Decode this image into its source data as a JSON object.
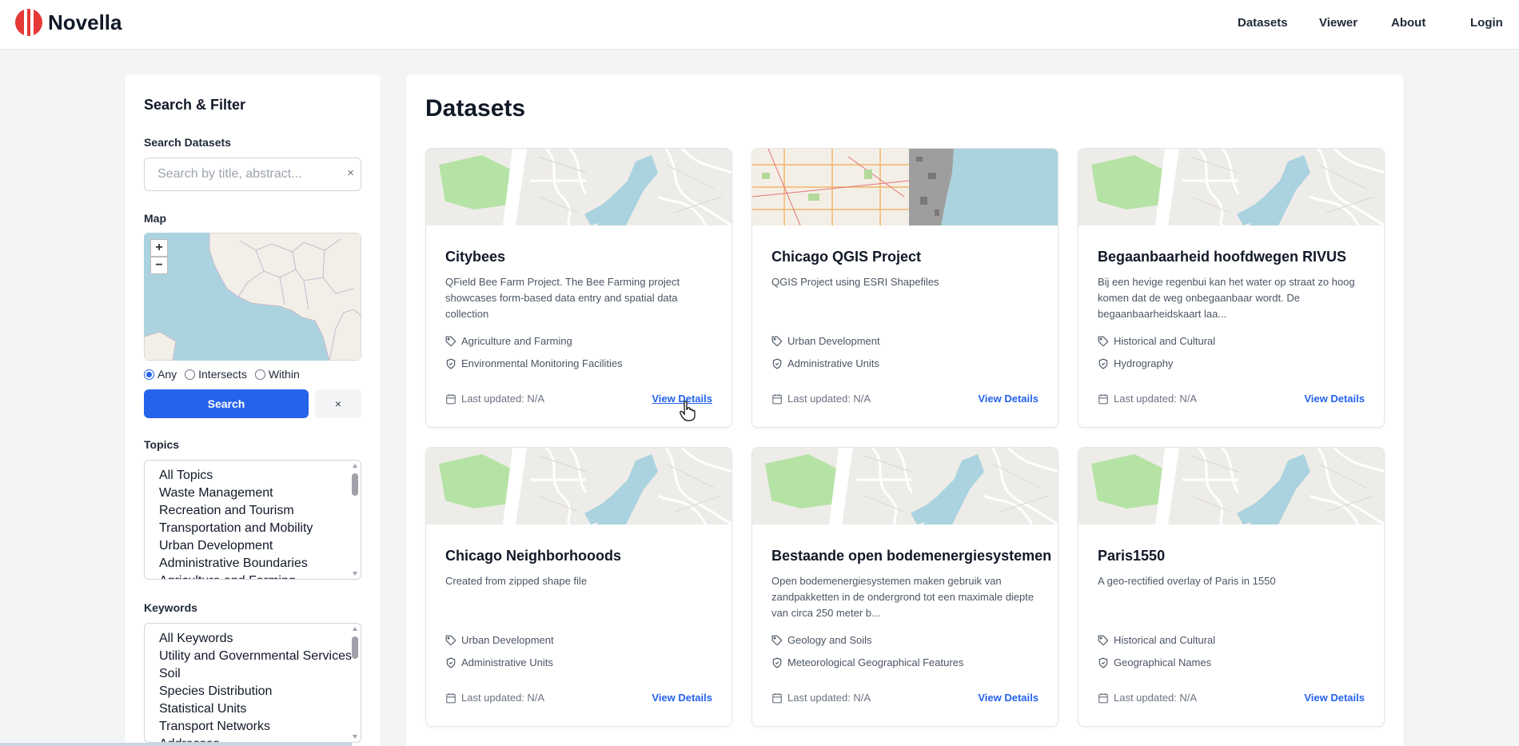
{
  "header": {
    "brand": "Novella",
    "nav": [
      "Datasets",
      "Viewer",
      "About",
      "Login"
    ]
  },
  "sidebar": {
    "title": "Search & Filter",
    "search_label": "Search Datasets",
    "search_placeholder": "Search by title, abstract...",
    "search_clear": "×",
    "map_label": "Map",
    "zoom_in": "+",
    "zoom_out": "−",
    "spatial_options": [
      "Any",
      "Intersects",
      "Within"
    ],
    "spatial_selected": "Any",
    "search_button": "Search",
    "clear_button": "×",
    "topics_label": "Topics",
    "topics": [
      "All Topics",
      "Waste Management",
      "Recreation and Tourism",
      "Transportation and Mobility",
      "Urban Development",
      "Administrative Boundaries",
      "Agriculture and Farming"
    ],
    "keywords_label": "Keywords",
    "keywords": [
      "All Keywords",
      "Utility and Governmental Services",
      "Soil",
      "Species Distribution",
      "Statistical Units",
      "Transport Networks",
      "Addresses"
    ]
  },
  "main": {
    "title": "Datasets",
    "updated_label": "Last updated: N/A",
    "details_label": "View Details",
    "cards": [
      {
        "title": "Citybees",
        "desc": "QField Bee Farm Project. The Bee Farming project showcases form-based data entry and spatial data collection",
        "topic": "Agriculture and Farming",
        "keyword": "Environmental Monitoring Facilities",
        "map": "generic"
      },
      {
        "title": "Chicago QGIS Project",
        "desc": "QGIS Project using ESRI Shapefiles",
        "topic": "Urban Development",
        "keyword": "Administrative Units",
        "map": "chicago"
      },
      {
        "title": "Begaanbaarheid hoofdwegen RIVUS",
        "desc": "Bij een hevige regenbui kan het water op straat zo hoog komen dat de weg onbegaanbaar wordt. De begaanbaarheidskaart laa...",
        "topic": "Historical and Cultural",
        "keyword": "Hydrography",
        "map": "generic"
      },
      {
        "title": "Chicago Neighborhooods",
        "desc": "Created from zipped shape file",
        "topic": "Urban Development",
        "keyword": "Administrative Units",
        "map": "generic"
      },
      {
        "title": "Bestaande open bodemenergiesystemen",
        "desc": "Open bodemenergiesystemen maken gebruik van zandpakketten in de ondergrond tot een maximale diepte van circa 250 meter b...",
        "topic": "Geology and Soils",
        "keyword": "Meteorological Geographical Features",
        "map": "generic"
      },
      {
        "title": "Paris1550",
        "desc": "A geo-rectified overlay of Paris in 1550",
        "topic": "Historical and Cultural",
        "keyword": "Geographical Names",
        "map": "generic"
      }
    ]
  },
  "colors": {
    "accent": "#2563eb",
    "brand": "#e53935",
    "water": "#aad3df",
    "park": "#b5e3a5"
  },
  "icons": {
    "tag": "tag-icon",
    "shield": "shield-icon",
    "calendar": "calendar-icon"
  }
}
